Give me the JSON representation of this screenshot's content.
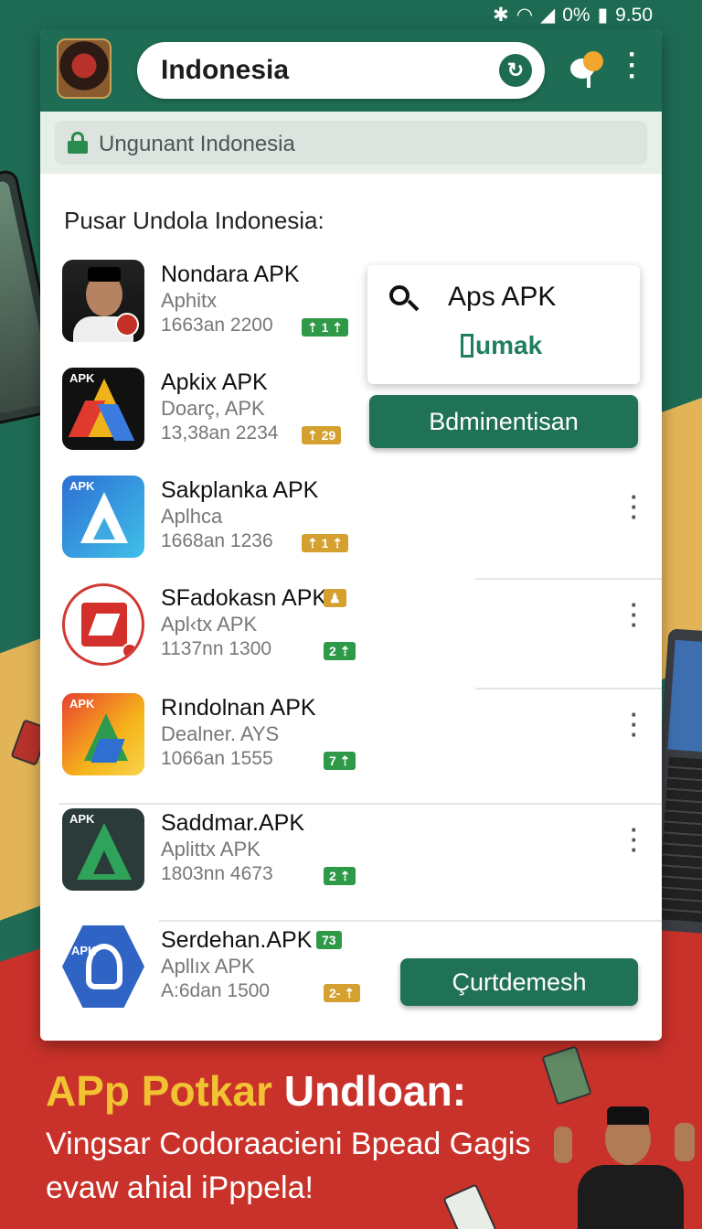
{
  "status_bar": {
    "battery": "0%",
    "time": "9.50"
  },
  "header": {
    "search_value": "Indonesia",
    "url_text": "Ungunant Indonesia"
  },
  "section_title": "Pusar Undola Indonesia:",
  "apps": [
    {
      "name": "Nondara APK",
      "sub": "Aphitx",
      "stats": "1663an  2200",
      "badge": "1",
      "badge_color": "#2e9a48"
    },
    {
      "name": "Apkix APK",
      "sub": "Doarç, APK",
      "stats": "13,38an  2234",
      "badge": "29",
      "badge_color": "#d4a030"
    },
    {
      "name": "Sakplanka APK",
      "sub": "Aplhca",
      "stats": "1668an  1236",
      "badge": "1",
      "badge_color": "#d4a030"
    },
    {
      "name": "SFadokasn APK",
      "sub": "Apl‹tx APK",
      "stats": "1137nn  1300",
      "badge": "2",
      "badge_color": "#2e9a48",
      "name_badge": ""
    },
    {
      "name": "Rındolnan APK",
      "sub": "Dealner. AYS",
      "stats": "1066an  1555",
      "badge": "7",
      "badge_color": "#2e9a48"
    },
    {
      "name": "Saddmar.APK",
      "sub": "Aplittx APK",
      "stats": "1803nn  4673",
      "badge": "2",
      "badge_color": "#2e9a48"
    },
    {
      "name": "Serdehan.APK",
      "sub": "Apllıx APK",
      "stats": "A:6dan  1500",
      "badge": "2",
      "badge_color": "#d4a030",
      "name_badge": "73"
    }
  ],
  "popup": {
    "title": "Aps APK",
    "subtitle": "umak"
  },
  "buttons": {
    "primary": "Bdminentisan",
    "secondary": "Çurtdemesh"
  },
  "banner": {
    "title_yellow": "APp Potkar",
    "title_white": "Undloan:",
    "line1": "Vingsar Codoraacieni Bpead Gagis",
    "line2": "evaw ahial iPppela!"
  },
  "colors": {
    "primary_green": "#1f6c54",
    "accent_yellow": "#f1c232",
    "banner_red": "#c9322a"
  }
}
